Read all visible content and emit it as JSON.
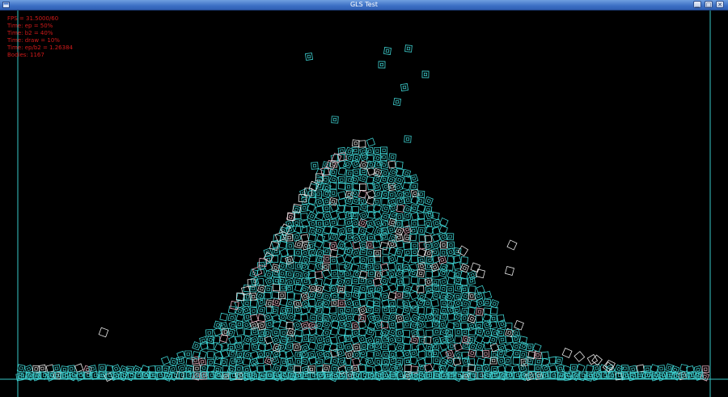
{
  "window": {
    "title": "GLS Test",
    "buttons": {
      "minimize_glyph": "▁",
      "maximize_glyph": "□",
      "close_glyph": "✕"
    }
  },
  "hud": {
    "lines": [
      "FPS = 31.5000/60",
      "Time: ep = 50%",
      "Time: b2 = 40%",
      "Time: draw = 10%",
      "Time: ep/b2 = 1.26384",
      "Bodies: 1167"
    ]
  },
  "scene": {
    "body_count": 1167,
    "colors": {
      "background": "#000000",
      "box_cyan": "#3fd3d3",
      "box_white": "#e8e8e8",
      "box_pink": "#e8b0c0",
      "wall": "#37c8c8",
      "hud_text": "#d21a1a"
    }
  }
}
